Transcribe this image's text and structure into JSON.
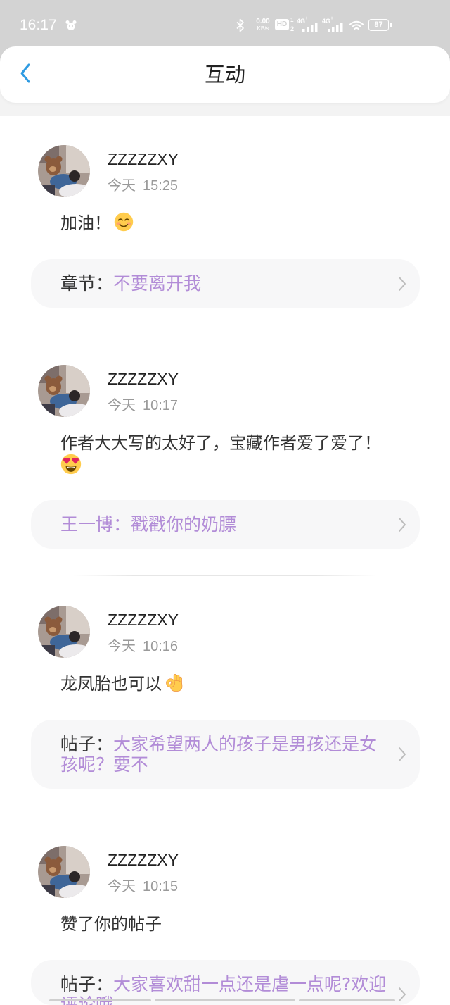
{
  "status_bar": {
    "time": "16:17",
    "net_speed_value": "0.00",
    "net_speed_unit": "KB/s",
    "hd_label": "HD",
    "hd_sim_top": "1",
    "hd_sim_bottom": "2",
    "signal_1_type": "4G",
    "signal_1_plus": "+",
    "signal_2_type": "4G",
    "signal_2_plus": "+",
    "battery_level": "87",
    "icons": {
      "notification": "app-notification-icon",
      "bluetooth": "bluetooth-icon",
      "signal": "signal-strength-icon",
      "wifi": "wifi-icon",
      "battery": "battery-icon"
    }
  },
  "header": {
    "title": "互动",
    "back_icon": "back-chevron-icon"
  },
  "colors": {
    "accent_blue": "#2e9be2",
    "link_purple": "#b28cd7",
    "text_primary": "#333333",
    "text_secondary": "#9a9a9a",
    "card_bg": "#f7f7f8",
    "status_bar_bg": "#d3d3d3"
  },
  "interactions": [
    {
      "user": "ZZZZZXY",
      "day": "今天",
      "time": "15:25",
      "comment": "加油！",
      "emoji_icon": "smiling-face-emoji-icon",
      "ref": {
        "prefix": "章节：",
        "title": "不要离开我"
      }
    },
    {
      "user": "ZZZZZXY",
      "day": "今天",
      "time": "10:17",
      "comment": "作者大大写的太好了，宝藏作者爱了爱了！",
      "emoji_icon": "heart-eyes-emoji-icon",
      "ref": {
        "title": "王一博：戳戳你的奶膘"
      }
    },
    {
      "user": "ZZZZZXY",
      "day": "今天",
      "time": "10:16",
      "comment": "龙凤胎也可以",
      "emoji_icon": "ok-hand-emoji-icon",
      "ref": {
        "prefix": "帖子：",
        "title": "大家希望两人的孩子是男孩还是女孩呢？要不"
      }
    },
    {
      "user": "ZZZZZXY",
      "day": "今天",
      "time": "10:15",
      "comment": "赞了你的帖子",
      "ref": {
        "prefix": "帖子：",
        "title": "大家喜欢甜一点还是虐一点呢?欢迎评论哦"
      }
    }
  ]
}
